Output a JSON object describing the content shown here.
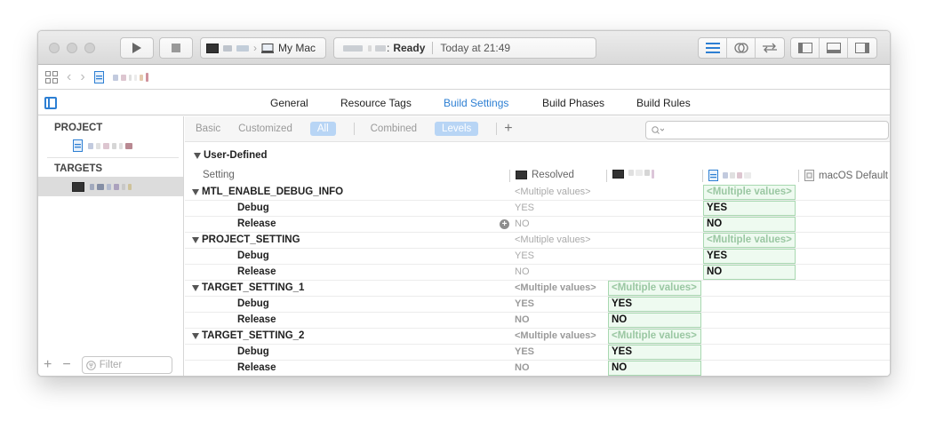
{
  "toolbar": {
    "scheme_target": "My Mac",
    "status_text": "Ready",
    "status_time": "Today at 21:49"
  },
  "tabs": [
    {
      "label": "General"
    },
    {
      "label": "Resource Tags"
    },
    {
      "label": "Build Settings",
      "active": true
    },
    {
      "label": "Build Phases"
    },
    {
      "label": "Build Rules"
    }
  ],
  "sidebar": {
    "project_header": "PROJECT",
    "targets_header": "TARGETS",
    "filter_placeholder": "Filter"
  },
  "filterbar": {
    "items": [
      "Basic",
      "Customized",
      "All",
      "Combined",
      "Levels"
    ],
    "selected": [
      "All",
      "Levels"
    ]
  },
  "section": {
    "title": "User-Defined",
    "columns": {
      "setting": "Setting",
      "resolved": "Resolved",
      "macos_default": "macOS Default"
    }
  },
  "rows": [
    {
      "name": "MTL_ENABLE_DEBUG_INFO",
      "resolved": "<Multiple values>",
      "project_value": "<Multiple values>",
      "kind": "parent"
    },
    {
      "name": "Debug",
      "resolved": "YES",
      "project_value": "YES",
      "kind": "child"
    },
    {
      "name": "Release",
      "resolved": "NO",
      "project_value": "NO",
      "kind": "child"
    },
    {
      "name": "PROJECT_SETTING",
      "resolved": "<Multiple values>",
      "project_value": "<Multiple values>",
      "kind": "parent"
    },
    {
      "name": "Debug",
      "resolved": "YES",
      "project_value": "YES",
      "kind": "child"
    },
    {
      "name": "Release",
      "resolved": "NO",
      "project_value": "NO",
      "kind": "child"
    },
    {
      "name": "TARGET_SETTING_1",
      "resolved": "<Multiple values>",
      "target_value": "<Multiple values>",
      "kind": "parent"
    },
    {
      "name": "Debug",
      "resolved": "YES",
      "target_value": "YES",
      "kind": "child"
    },
    {
      "name": "Release",
      "resolved": "NO",
      "target_value": "NO",
      "kind": "child"
    },
    {
      "name": "TARGET_SETTING_2",
      "resolved": "<Multiple values>",
      "target_value": "<Multiple values>",
      "kind": "parent"
    },
    {
      "name": "Debug",
      "resolved": "YES",
      "target_value": "YES",
      "kind": "child"
    },
    {
      "name": "Release",
      "resolved": "NO",
      "target_value": "NO",
      "kind": "child"
    }
  ],
  "colors": {
    "accent": "#2d7fd3",
    "value_box_border": "#a8d8b0",
    "value_box_fill": "#eefaf0"
  }
}
